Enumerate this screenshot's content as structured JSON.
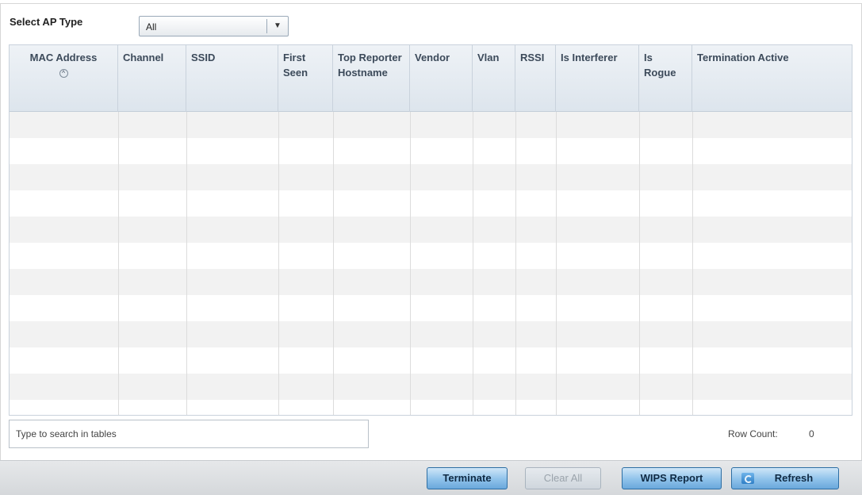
{
  "filter": {
    "label": "Select AP Type",
    "selected": "All"
  },
  "table": {
    "columns": [
      {
        "key": "mac",
        "label": "MAC Address",
        "sorted": true
      },
      {
        "key": "channel",
        "label": "Channel"
      },
      {
        "key": "ssid",
        "label": "SSID"
      },
      {
        "key": "first_seen",
        "label": "First Seen"
      },
      {
        "key": "top_reporter",
        "label": "Top Reporter Hostname"
      },
      {
        "key": "vendor",
        "label": "Vendor"
      },
      {
        "key": "vlan",
        "label": "Vlan"
      },
      {
        "key": "rssi",
        "label": "RSSI"
      },
      {
        "key": "interferer",
        "label": "Is Interferer"
      },
      {
        "key": "rogue",
        "label": "Is Rogue"
      },
      {
        "key": "termination",
        "label": "Termination Active"
      }
    ],
    "rows": []
  },
  "search": {
    "placeholder": "Type to search in tables"
  },
  "row_count": {
    "label": "Row Count:",
    "value": "0"
  },
  "buttons": {
    "terminate": "Terminate",
    "clear_all": "Clear All",
    "wips_report": "WIPS Report",
    "refresh": "Refresh"
  },
  "icons": {
    "sort": "sort-ascending-icon",
    "dropdown": "chevron-down-icon",
    "refresh": "refresh-icon"
  },
  "colors": {
    "header_bg": "#dde5ed",
    "button_accent": "#8fc2ea",
    "stripe": "#f2f2f2"
  }
}
